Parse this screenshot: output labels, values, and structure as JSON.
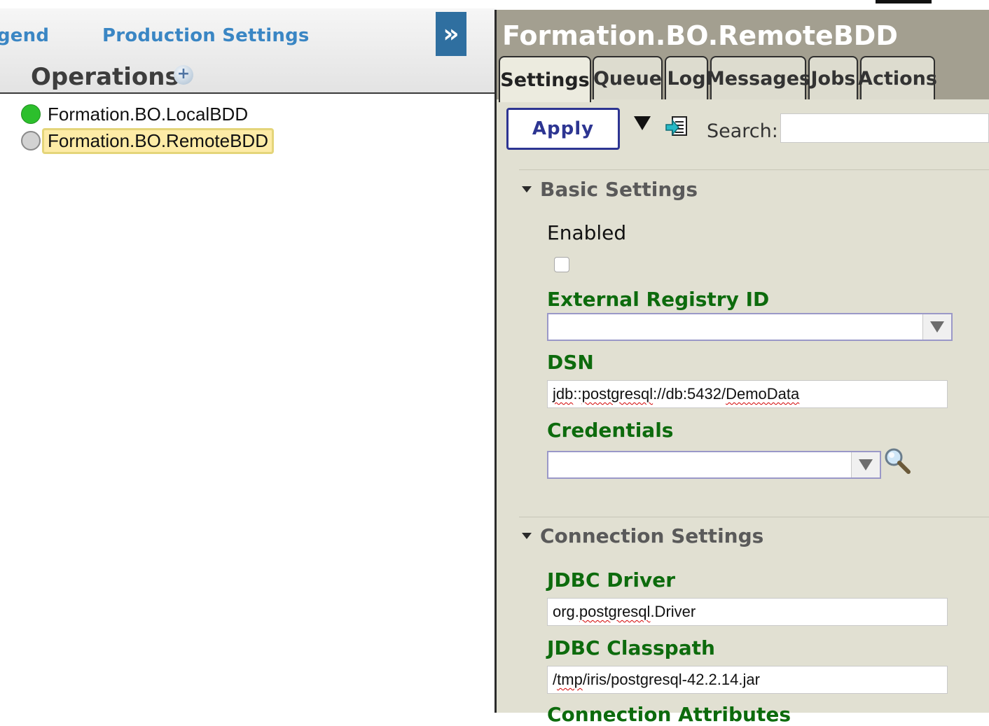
{
  "left_panel": {
    "links": {
      "legend": "gend",
      "production_settings": "Production Settings"
    },
    "collapse_label": "»",
    "section_title": "Operations",
    "add_symbol": "+",
    "operations": [
      {
        "name": "Formation.BO.LocalBDD",
        "status": "enabled"
      },
      {
        "name": "Formation.BO.RemoteBDD",
        "status": "disabled",
        "selected": true
      }
    ]
  },
  "right_panel": {
    "title": "Formation.BO.RemoteBDD",
    "tabs": [
      "Settings",
      "Queue",
      "Log",
      "Messages",
      "Jobs",
      "Actions"
    ],
    "active_tab": "Settings",
    "toolbar": {
      "apply_label": "Apply",
      "search_label": "Search:",
      "search_value": ""
    },
    "basic_settings": {
      "title": "Basic Settings",
      "enabled_label": "Enabled",
      "enabled_checked": false,
      "external_registry_label": "External Registry ID",
      "external_registry_value": "",
      "dsn_label": "DSN",
      "dsn_value": "jdb::postgresql://db:5432/DemoData",
      "credentials_label": "Credentials",
      "credentials_value": ""
    },
    "connection_settings": {
      "title": "Connection Settings",
      "jdbc_driver_label": "JDBC Driver",
      "jdbc_driver_value": "org.postgresql.Driver",
      "jdbc_classpath_label": "JDBC Classpath",
      "jdbc_classpath_value": "/tmp/iris/postgresql-42.2.14.jar",
      "next_label_partial": "Connection Attributes"
    }
  },
  "colors": {
    "link_blue": "#3a86c4",
    "collapse_button": "#2f6fa0",
    "header_gray": "#a39f90",
    "panel_bg": "#e1e0d2",
    "label_green": "#0d6b0d",
    "apply_navy": "#2d3592",
    "status_green": "#2cbf2c",
    "selected_highlight": "#fdeba6"
  },
  "icons": {
    "collapse": "double-chevron-right-icon",
    "add": "plus-circle-icon",
    "export": "document-export-icon",
    "lookup": "magnifier-icon"
  }
}
